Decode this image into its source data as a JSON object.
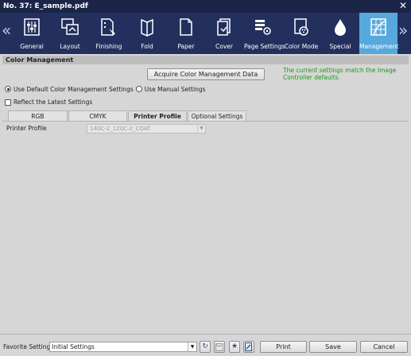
{
  "window": {
    "title": "No. 37: E_sample.pdf"
  },
  "toolbar": {
    "items": [
      {
        "label": "General",
        "icon": "sliders-icon"
      },
      {
        "label": "Layout",
        "icon": "layout-icon"
      },
      {
        "label": "Finishing",
        "icon": "finishing-icon"
      },
      {
        "label": "Fold",
        "icon": "fold-icon"
      },
      {
        "label": "Paper",
        "icon": "paper-icon"
      },
      {
        "label": "Cover",
        "icon": "cover-icon"
      },
      {
        "label": "Page Settings",
        "icon": "page-settings-icon"
      },
      {
        "label": "Color Mode",
        "icon": "color-mode-icon"
      },
      {
        "label": "Special",
        "icon": "droplet-icon"
      },
      {
        "label": "Management",
        "icon": "management-icon"
      }
    ],
    "active": "Management",
    "active_color": "#57a9dd"
  },
  "panel": {
    "title": "Color Management",
    "acquire_button": "Acquire Color Management Data",
    "info_text": "The current settings match the Image Controller defaults.",
    "radio_default": "Use Default Color Management Settings",
    "radio_manual": "Use Manual Settings",
    "check_reflect": "Reflect the Latest Settings",
    "tabs": [
      "RGB",
      "CMYK",
      "Printer Profile",
      "Optional Settings"
    ],
    "active_tab": "Printer Profile",
    "printer_profile_label": "Printer Profile",
    "printer_profile_value": "140C-2_120C-2_COAT"
  },
  "footer": {
    "favorite_label": "Favorite Setting",
    "favorite_value": "Initial Settings",
    "print": "Print",
    "save": "Save",
    "cancel": "Cancel"
  }
}
